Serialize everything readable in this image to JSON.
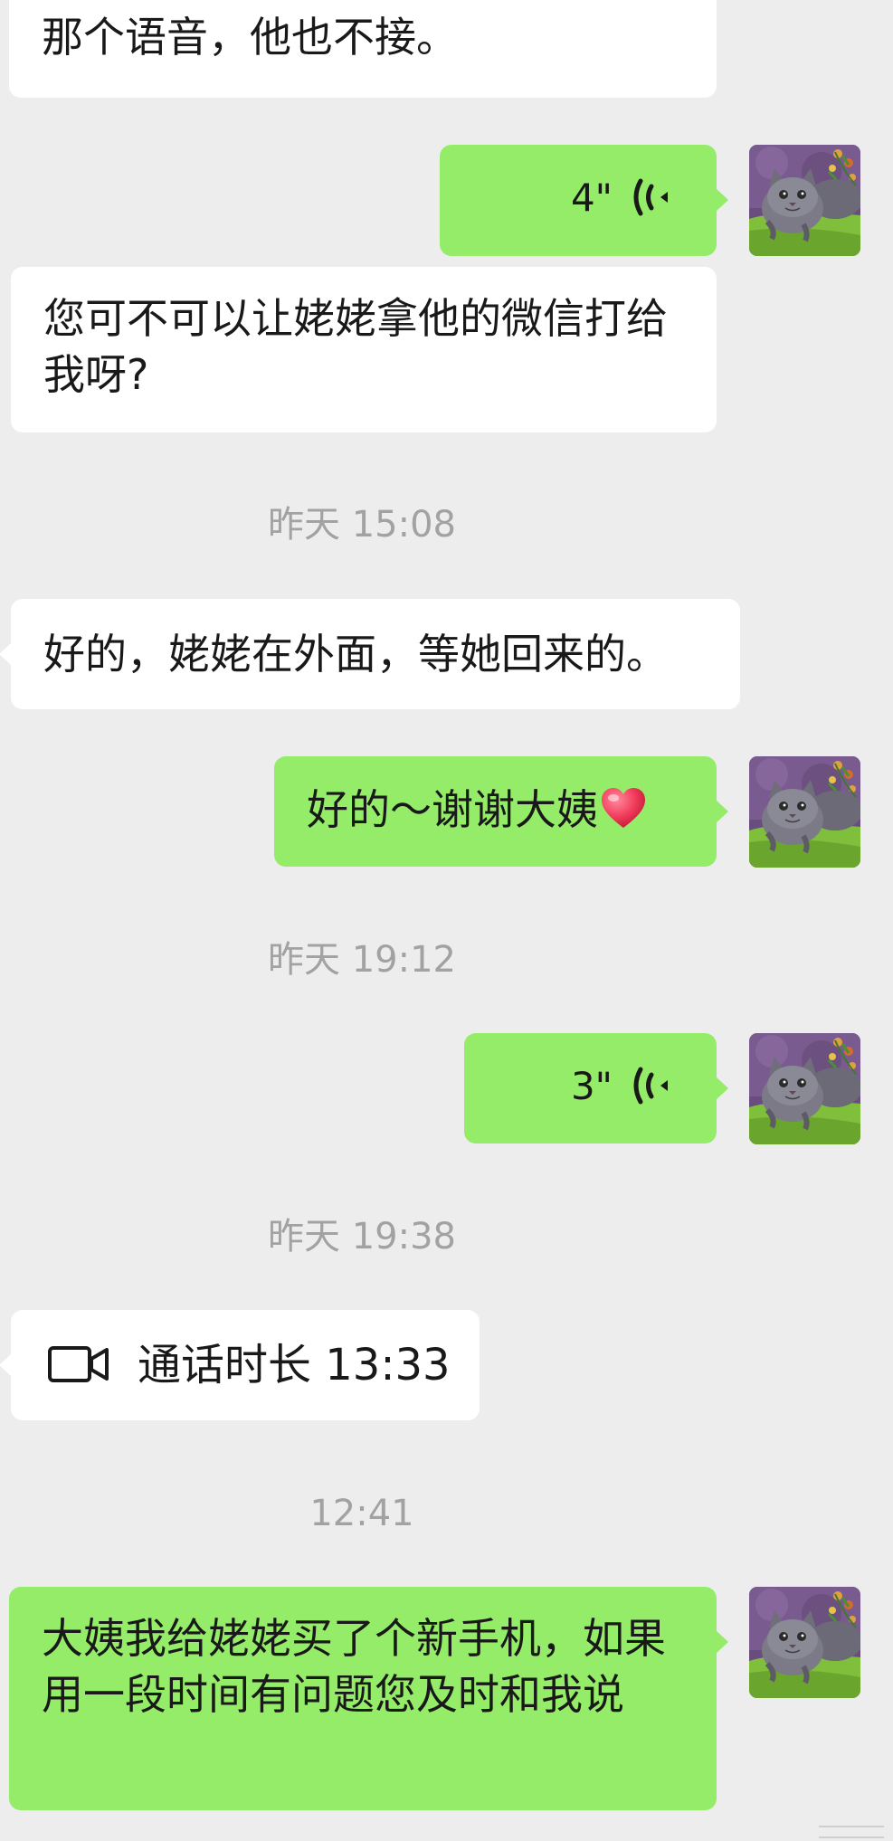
{
  "messages": {
    "m1": {
      "text": "那个语音，他也不接。"
    },
    "m2": {
      "duration": "4\""
    },
    "m3": {
      "text": "您可不可以让姥姥拿他的微信打给我呀?"
    },
    "t1": {
      "text": "昨天 15:08"
    },
    "m4": {
      "text": "好的，姥姥在外面，等她回来的。"
    },
    "m5": {
      "text": "好的～谢谢大姨",
      "emoji": "heart-emoji"
    },
    "t2": {
      "text": "昨天 19:12"
    },
    "m6": {
      "duration": "3\""
    },
    "t3": {
      "text": "昨天 19:38"
    },
    "m7": {
      "text": "通话时长 13:33"
    },
    "t4": {
      "text": "12:41"
    },
    "m8": {
      "text": "大姨我给姥姥买了个新手机，如果用一段时间有问题您及时和我说"
    }
  },
  "colors": {
    "background": "#ededed",
    "incoming_bubble": "#ffffff",
    "outgoing_bubble": "#95ec69",
    "timestamp": "#a2a2a2",
    "text": "#191919"
  },
  "icons": {
    "voice": "voice-wave-icon",
    "video_call": "video-camera-icon",
    "avatar": "cat-avatar"
  }
}
